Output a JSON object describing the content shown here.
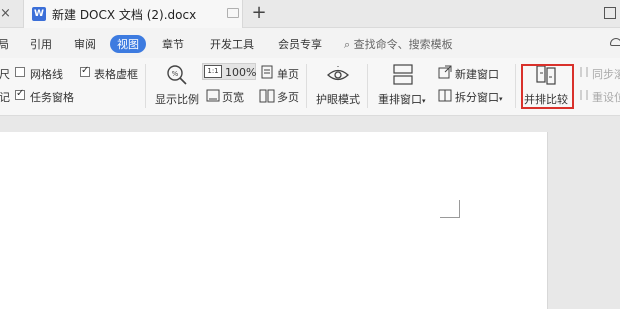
{
  "tabbar": {
    "left_close": "×",
    "doc_icon": "W",
    "doc_title": "新建 DOCX 文档 (2).docx",
    "new_tab": "+"
  },
  "menu": {
    "items": [
      "局",
      "引用",
      "审阅",
      "视图",
      "章节",
      "开发工具",
      "会员专享"
    ],
    "active": "视图",
    "search_placeholder": "查找命令、搜索模板"
  },
  "ribbon": {
    "ruler_partial": "尺",
    "gridlines": "网格线",
    "table_frame": "表格虚框",
    "marker_partial": "记",
    "task_pane": "任务窗格",
    "zoom_label": "显示比例",
    "zoom_value": "100%",
    "page_width": "页宽",
    "single_page": "单页",
    "multi_page": "多页",
    "eye_mode": "护眼模式",
    "arrange_window": "重排窗口",
    "new_window": "新建窗口",
    "split_window": "拆分窗口",
    "side_by_side": "并排比较",
    "sync_scroll_partial": "同步滚",
    "reset_pos_partial": "重设位"
  },
  "icons": {
    "close": "close-icon",
    "doc": "document-icon",
    "search": "search-icon",
    "zoom": "zoom-icon",
    "eye": "eye-icon",
    "arrange": "arrange-window-icon",
    "new_window": "new-window-icon",
    "split": "split-window-icon",
    "compare": "side-by-side-icon"
  },
  "colors": {
    "accent": "#3d7be0",
    "highlight": "#d9312b"
  }
}
